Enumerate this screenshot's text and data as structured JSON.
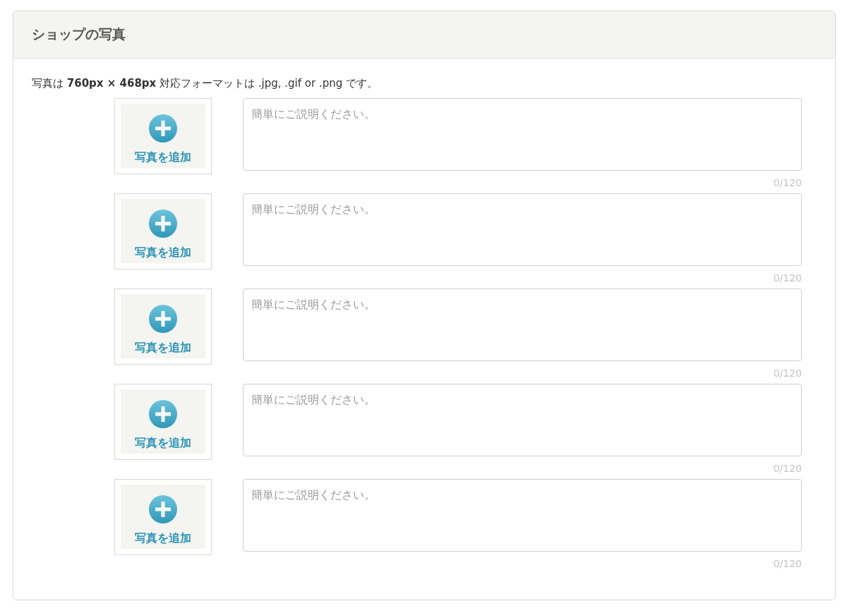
{
  "panel": {
    "title": "ショップの写真",
    "description": "写真は **760px × 468px** 対応フォーマットは .jpg, .gif or .png です。"
  },
  "photos": [
    {
      "add_label": "写真を追加",
      "placeholder": "簡単にご説明ください。",
      "counter": "0/120"
    },
    {
      "add_label": "写真を追加",
      "placeholder": "簡単にご説明ください。",
      "counter": "0/120"
    },
    {
      "add_label": "写真を追加",
      "placeholder": "簡単にご説明ください。",
      "counter": "0/120"
    },
    {
      "add_label": "写真を追加",
      "placeholder": "簡単にご説明ください。",
      "counter": "0/120"
    },
    {
      "add_label": "写真を追加",
      "placeholder": "簡単にご説明ください。",
      "counter": "0/120"
    }
  ]
}
